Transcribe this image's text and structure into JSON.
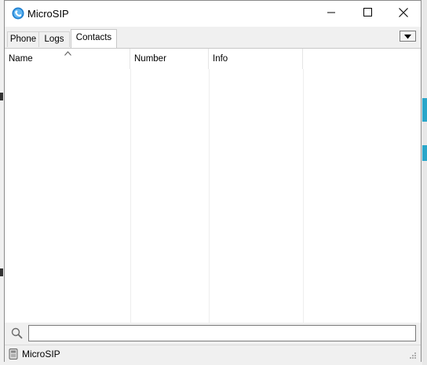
{
  "window": {
    "title": "MicroSIP"
  },
  "tabs": [
    {
      "label": "Phone",
      "active": false
    },
    {
      "label": "Logs",
      "active": false
    },
    {
      "label": "Contacts",
      "active": true
    }
  ],
  "contacts_table": {
    "columns": [
      "Name",
      "Number",
      "Info"
    ],
    "sort_column": "Name",
    "rows": []
  },
  "search": {
    "value": "",
    "placeholder": ""
  },
  "status": {
    "text": "MicroSIP"
  },
  "colors": {
    "accent": "#1e7fd0",
    "panel": "#ffffff",
    "chrome": "#f0f0f0"
  },
  "icons": {
    "app": "microsip-logo-icon",
    "minimize": "minimize-icon",
    "maximize": "maximize-icon",
    "close": "close-icon",
    "menu": "dropdown-arrow-icon",
    "sort": "sort-ascending-icon",
    "search": "search-icon",
    "status": "device-status-icon"
  }
}
